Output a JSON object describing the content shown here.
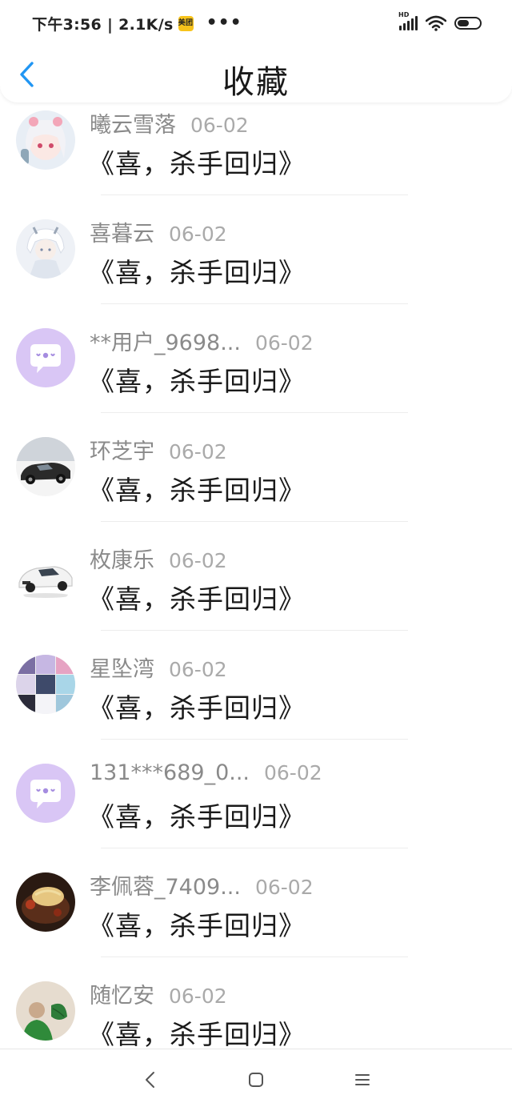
{
  "status_bar": {
    "time_speed": "下午3:56 | 2.1K/s",
    "app_badge": "美团",
    "overflow": "•••",
    "network": "HD"
  },
  "header": {
    "title": "收藏",
    "back_icon": "chevron-left-icon",
    "accent": "#2196f3"
  },
  "favorites": [
    {
      "name": "曦云雪落",
      "date": "06-02",
      "title": "《喜，杀手回归》",
      "avatar": "anime-girl-pink"
    },
    {
      "name": "喜暮云",
      "date": "06-02",
      "title": "《喜，杀手回归》",
      "avatar": "anime-boy-white"
    },
    {
      "name": "**用户_9698...",
      "date": "06-02",
      "title": "《喜，杀手回归》",
      "avatar": "chat-bubble-default"
    },
    {
      "name": "环芝宇",
      "date": "06-02",
      "title": "《喜，杀手回归》",
      "avatar": "sports-car-black"
    },
    {
      "name": "枚康乐",
      "date": "06-02",
      "title": "《喜，杀手回归》",
      "avatar": "sports-car-white"
    },
    {
      "name": "星坠湾",
      "date": "06-02",
      "title": "《喜，杀手回归》",
      "avatar": "anime-collage"
    },
    {
      "name": "131***689_0...",
      "date": "06-02",
      "title": "《喜，杀手回归》",
      "avatar": "chat-bubble-default"
    },
    {
      "name": "李佩蓉_7409...",
      "date": "06-02",
      "title": "《喜，杀手回归》",
      "avatar": "food-plate"
    },
    {
      "name": "随忆安",
      "date": "06-02",
      "title": "《喜，杀手回归》",
      "avatar": "person-green"
    }
  ],
  "nav_bar": {
    "back_icon": "nav-back-icon",
    "home_icon": "nav-home-icon",
    "menu_icon": "nav-menu-icon"
  }
}
